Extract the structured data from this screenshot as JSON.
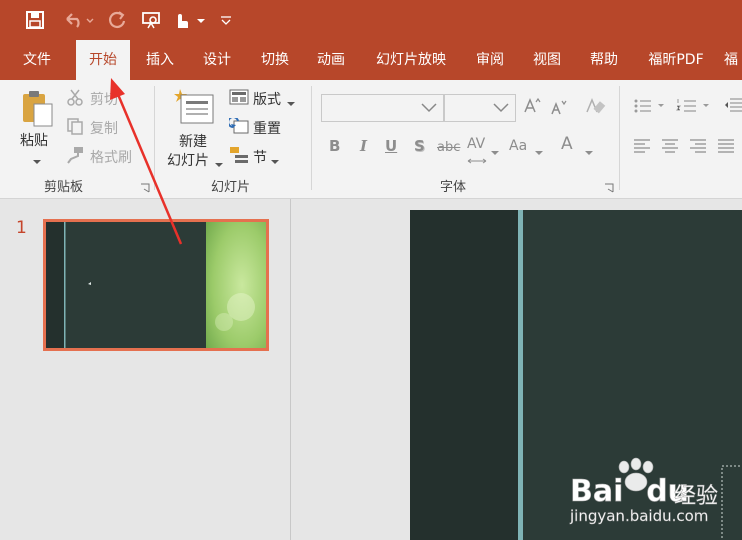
{
  "quick_access": {
    "icons": [
      "save-icon",
      "undo-icon",
      "redo-icon",
      "present-from-start-icon",
      "touch-mode-icon",
      "customize-icon"
    ]
  },
  "tabs": [
    "文件",
    "开始",
    "插入",
    "设计",
    "切换",
    "动画",
    "幻灯片放映",
    "审阅",
    "视图",
    "帮助",
    "福昕PDF",
    "福"
  ],
  "active_tab": "开始",
  "ribbon": {
    "clipboard": {
      "paste_label": "粘贴",
      "cut_label": "剪切",
      "copy_label": "复制",
      "format_painter_label": "格式刷",
      "group_label": "剪贴板"
    },
    "slides": {
      "new_slide_line1": "新建",
      "new_slide_line2": "幻灯片",
      "layout_label": "版式",
      "reset_label": "重置",
      "section_label": "节",
      "group_label": "幻灯片"
    },
    "font": {
      "font_name_value": "",
      "font_size_value": "",
      "bold": "B",
      "italic": "I",
      "underline": "U",
      "shadow": "S",
      "strikethrough": "abc",
      "char_spacing": "AV",
      "change_case": "Aa",
      "font_color": "A",
      "group_label": "字体"
    }
  },
  "slides_panel": {
    "slide_number": "1"
  },
  "watermark": {
    "brand": "Bai",
    "brand2": "du",
    "cn": "经验",
    "url": "jingyan.baidu.com"
  },
  "colors": {
    "accent": "#b7472a",
    "ribbon_bg": "#f3f3f3",
    "slide_dark": "#2b3a36",
    "slide_stripe": "#7fb3b5",
    "selection": "#e5704f",
    "arrow": "#e8312a"
  }
}
